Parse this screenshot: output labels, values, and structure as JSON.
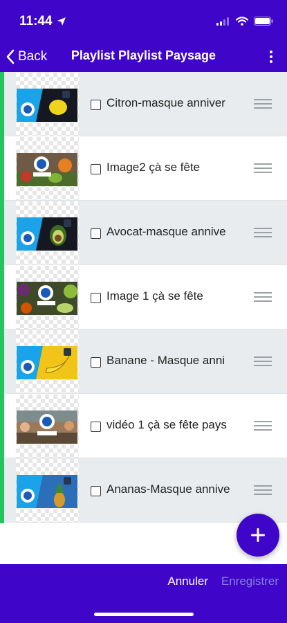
{
  "status_bar": {
    "time": "11:44"
  },
  "nav": {
    "back_label": "Back",
    "title": "Playlist Playlist Paysage"
  },
  "items": [
    {
      "label": "Citron-masque anniver"
    },
    {
      "label": "Image2 çà se fête"
    },
    {
      "label": "Avocat-masque annive"
    },
    {
      "label": "Image 1 çà se fête"
    },
    {
      "label": "Banane - Masque anni"
    },
    {
      "label": "vidéo 1 çà se fête pays"
    },
    {
      "label": "Ananas-Masque annive"
    }
  ],
  "footer": {
    "cancel_label": "Annuler",
    "save_label": "Enregistrer"
  },
  "colors": {
    "primary": "#3f06c9",
    "accent_bar": "#22c55e",
    "save_disabled": "#8b7fd9"
  }
}
